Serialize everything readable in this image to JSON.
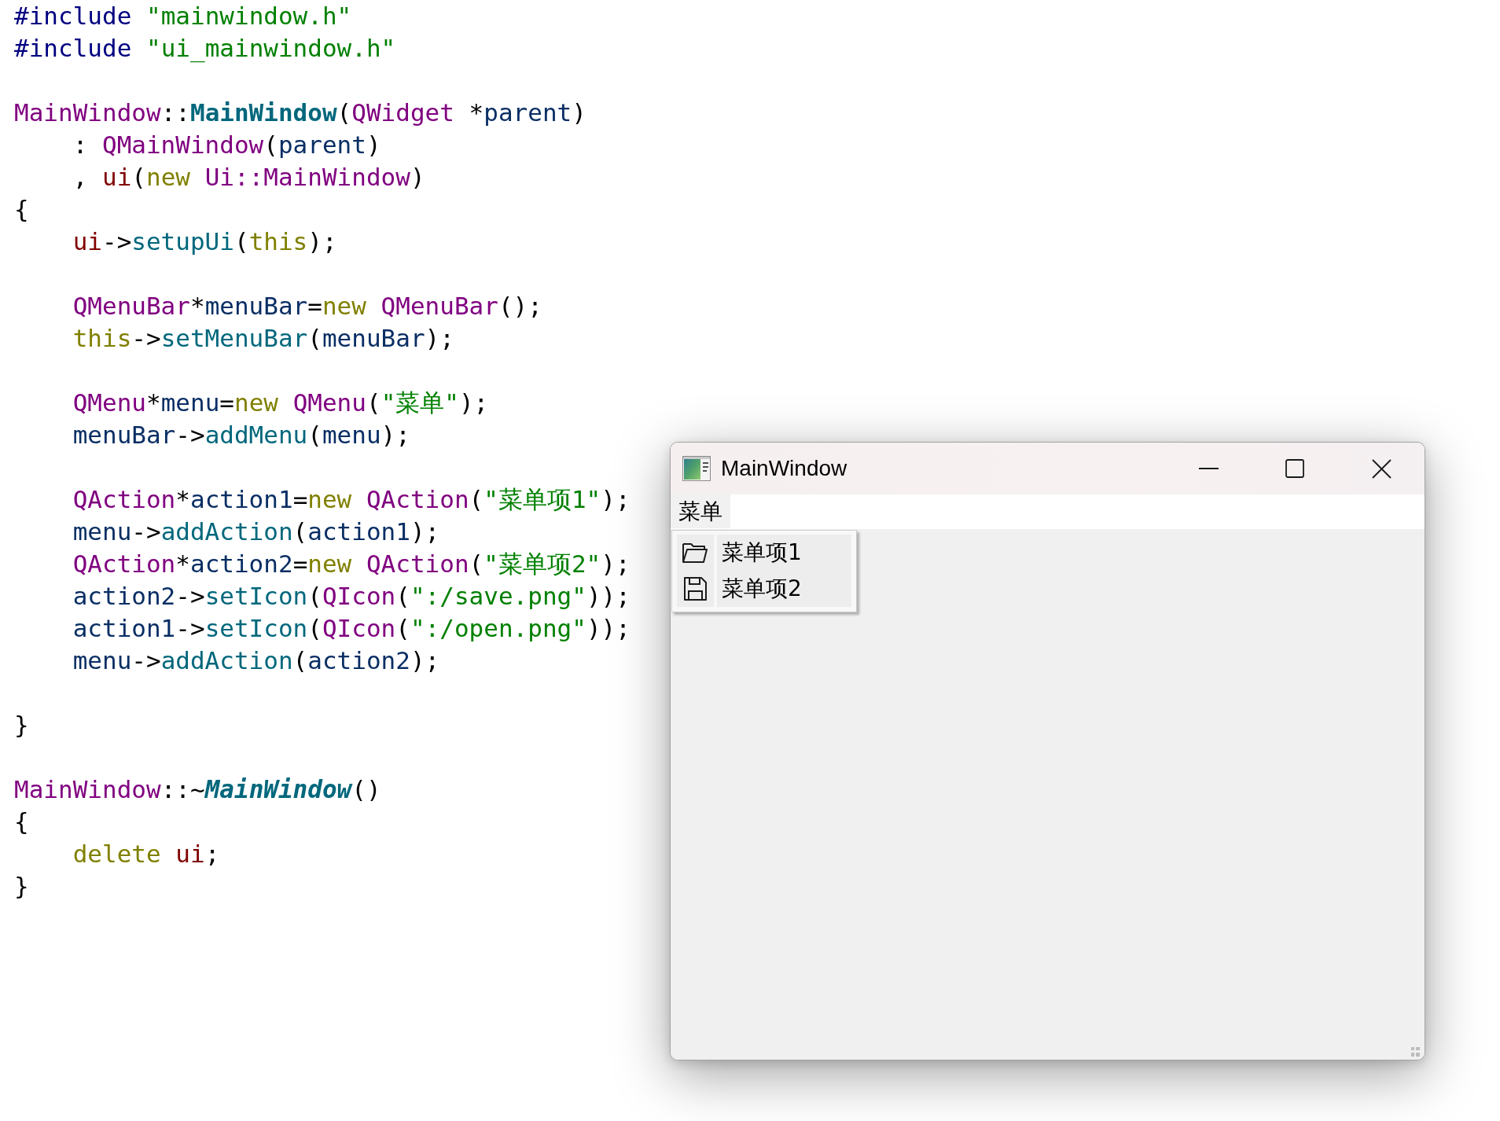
{
  "editor": {
    "blocks": [
      {
        "lines": [
          {
            "indented": false,
            "tokens": [
              {
                "text": "#include ",
                "kind": "preprocessor"
              },
              {
                "text": "\"mainwindow.h\"",
                "kind": "string"
              }
            ]
          },
          {
            "indented": false,
            "tokens": [
              {
                "text": "#include ",
                "kind": "preprocessor"
              },
              {
                "text": "\"ui_mainwindow.h\"",
                "kind": "string"
              }
            ]
          }
        ]
      },
      {
        "lines": [
          {
            "indented": false,
            "tokens": [
              {
                "text": "MainWindow",
                "kind": "type"
              },
              {
                "text": "::",
                "kind": "plain"
              },
              {
                "text": "MainWindow",
                "kind": "declaration"
              },
              {
                "text": "(",
                "kind": "plain"
              },
              {
                "text": "QWidget",
                "kind": "type"
              },
              {
                "text": " *",
                "kind": "plain"
              },
              {
                "text": "parent",
                "kind": "local"
              },
              {
                "text": ")",
                "kind": "plain"
              }
            ]
          },
          {
            "indented": true,
            "tokens": [
              {
                "text": ": ",
                "kind": "plain"
              },
              {
                "text": "QMainWindow",
                "kind": "type"
              },
              {
                "text": "(",
                "kind": "plain"
              },
              {
                "text": "parent",
                "kind": "local"
              },
              {
                "text": ")",
                "kind": "plain"
              }
            ]
          },
          {
            "indented": true,
            "tokens": [
              {
                "text": ", ",
                "kind": "plain"
              },
              {
                "text": "ui",
                "kind": "field"
              },
              {
                "text": "(",
                "kind": "plain"
              },
              {
                "text": "new ",
                "kind": "keyword"
              },
              {
                "text": "Ui::MainWindow",
                "kind": "type"
              },
              {
                "text": ")",
                "kind": "plain"
              }
            ]
          },
          {
            "indented": false,
            "tokens": [
              {
                "text": "{",
                "kind": "plain"
              }
            ]
          },
          {
            "indented": true,
            "tokens": [
              {
                "text": "ui",
                "kind": "field"
              },
              {
                "text": "->",
                "kind": "plain"
              },
              {
                "text": "setupUi",
                "kind": "function"
              },
              {
                "text": "(",
                "kind": "plain"
              },
              {
                "text": "this",
                "kind": "keyword"
              },
              {
                "text": ");",
                "kind": "plain"
              }
            ]
          }
        ]
      },
      {
        "lines": [
          {
            "indented": true,
            "tokens": [
              {
                "text": "QMenuBar",
                "kind": "type"
              },
              {
                "text": "*",
                "kind": "plain"
              },
              {
                "text": "menuBar",
                "kind": "local"
              },
              {
                "text": "=",
                "kind": "plain"
              },
              {
                "text": "new ",
                "kind": "keyword"
              },
              {
                "text": "QMenuBar",
                "kind": "type"
              },
              {
                "text": "();",
                "kind": "plain"
              }
            ]
          },
          {
            "indented": true,
            "tokens": [
              {
                "text": "this",
                "kind": "keyword"
              },
              {
                "text": "->",
                "kind": "plain"
              },
              {
                "text": "setMenuBar",
                "kind": "function"
              },
              {
                "text": "(",
                "kind": "plain"
              },
              {
                "text": "menuBar",
                "kind": "local"
              },
              {
                "text": ");",
                "kind": "plain"
              }
            ]
          }
        ]
      },
      {
        "lines": [
          {
            "indented": true,
            "tokens": [
              {
                "text": "QMenu",
                "kind": "type"
              },
              {
                "text": "*",
                "kind": "plain"
              },
              {
                "text": "menu",
                "kind": "local"
              },
              {
                "text": "=",
                "kind": "plain"
              },
              {
                "text": "new ",
                "kind": "keyword"
              },
              {
                "text": "QMenu",
                "kind": "type"
              },
              {
                "text": "(",
                "kind": "plain"
              },
              {
                "text": "\"菜单\"",
                "kind": "string"
              },
              {
                "text": ");",
                "kind": "plain"
              }
            ]
          },
          {
            "indented": true,
            "tokens": [
              {
                "text": "menuBar",
                "kind": "local"
              },
              {
                "text": "->",
                "kind": "plain"
              },
              {
                "text": "addMenu",
                "kind": "function"
              },
              {
                "text": "(",
                "kind": "plain"
              },
              {
                "text": "menu",
                "kind": "local"
              },
              {
                "text": ");",
                "kind": "plain"
              }
            ]
          }
        ]
      },
      {
        "lines": [
          {
            "indented": true,
            "tokens": [
              {
                "text": "QAction",
                "kind": "type"
              },
              {
                "text": "*",
                "kind": "plain"
              },
              {
                "text": "action1",
                "kind": "local"
              },
              {
                "text": "=",
                "kind": "plain"
              },
              {
                "text": "new ",
                "kind": "keyword"
              },
              {
                "text": "QAction",
                "kind": "type"
              },
              {
                "text": "(",
                "kind": "plain"
              },
              {
                "text": "\"菜单项1\"",
                "kind": "string"
              },
              {
                "text": ");",
                "kind": "plain"
              }
            ]
          },
          {
            "indented": true,
            "tokens": [
              {
                "text": "menu",
                "kind": "local"
              },
              {
                "text": "->",
                "kind": "plain"
              },
              {
                "text": "addAction",
                "kind": "function"
              },
              {
                "text": "(",
                "kind": "plain"
              },
              {
                "text": "action1",
                "kind": "local"
              },
              {
                "text": ");",
                "kind": "plain"
              }
            ]
          },
          {
            "indented": true,
            "tokens": [
              {
                "text": "QAction",
                "kind": "type"
              },
              {
                "text": "*",
                "kind": "plain"
              },
              {
                "text": "action2",
                "kind": "local"
              },
              {
                "text": "=",
                "kind": "plain"
              },
              {
                "text": "new ",
                "kind": "keyword"
              },
              {
                "text": "QAction",
                "kind": "type"
              },
              {
                "text": "(",
                "kind": "plain"
              },
              {
                "text": "\"菜单项2\"",
                "kind": "string"
              },
              {
                "text": ");",
                "kind": "plain"
              }
            ]
          },
          {
            "indented": true,
            "tokens": [
              {
                "text": "action2",
                "kind": "local"
              },
              {
                "text": "->",
                "kind": "plain"
              },
              {
                "text": "setIcon",
                "kind": "function"
              },
              {
                "text": "(",
                "kind": "plain"
              },
              {
                "text": "QIcon",
                "kind": "type"
              },
              {
                "text": "(",
                "kind": "plain"
              },
              {
                "text": "\":/save.png\"",
                "kind": "string"
              },
              {
                "text": "));",
                "kind": "plain"
              }
            ]
          },
          {
            "indented": true,
            "tokens": [
              {
                "text": "action1",
                "kind": "local"
              },
              {
                "text": "->",
                "kind": "plain"
              },
              {
                "text": "setIcon",
                "kind": "function"
              },
              {
                "text": "(",
                "kind": "plain"
              },
              {
                "text": "QIcon",
                "kind": "type"
              },
              {
                "text": "(",
                "kind": "plain"
              },
              {
                "text": "\":/open.png\"",
                "kind": "string"
              },
              {
                "text": "));",
                "kind": "plain"
              }
            ]
          },
          {
            "indented": true,
            "tokens": [
              {
                "text": "menu",
                "kind": "local"
              },
              {
                "text": "->",
                "kind": "plain"
              },
              {
                "text": "addAction",
                "kind": "function"
              },
              {
                "text": "(",
                "kind": "plain"
              },
              {
                "text": "action2",
                "kind": "local"
              },
              {
                "text": ");",
                "kind": "plain"
              }
            ]
          }
        ]
      },
      {
        "lines": [
          {
            "indented": false,
            "tokens": [
              {
                "text": "}",
                "kind": "plain"
              }
            ]
          }
        ]
      },
      {
        "lines": [
          {
            "indented": false,
            "tokens": [
              {
                "text": "MainWindow",
                "kind": "type"
              },
              {
                "text": "::~",
                "kind": "plain"
              },
              {
                "text": "MainWindow",
                "kind": "virtual_declaration"
              },
              {
                "text": "()",
                "kind": "plain"
              }
            ]
          },
          {
            "indented": false,
            "tokens": [
              {
                "text": "{",
                "kind": "plain"
              }
            ]
          },
          {
            "indented": true,
            "tokens": [
              {
                "text": "delete ",
                "kind": "keyword"
              },
              {
                "text": "ui",
                "kind": "field"
              },
              {
                "text": ";",
                "kind": "plain"
              }
            ]
          },
          {
            "indented": false,
            "tokens": [
              {
                "text": "}",
                "kind": "plain"
              }
            ]
          }
        ]
      }
    ]
  },
  "window": {
    "title": "MainWindow",
    "menu_bar": [
      {
        "label": "菜单",
        "selected": true
      }
    ],
    "open_menu": {
      "items": [
        {
          "label": "菜单项1",
          "selected": false
        },
        {
          "label": "菜单项2",
          "selected": false
        }
      ]
    }
  }
}
